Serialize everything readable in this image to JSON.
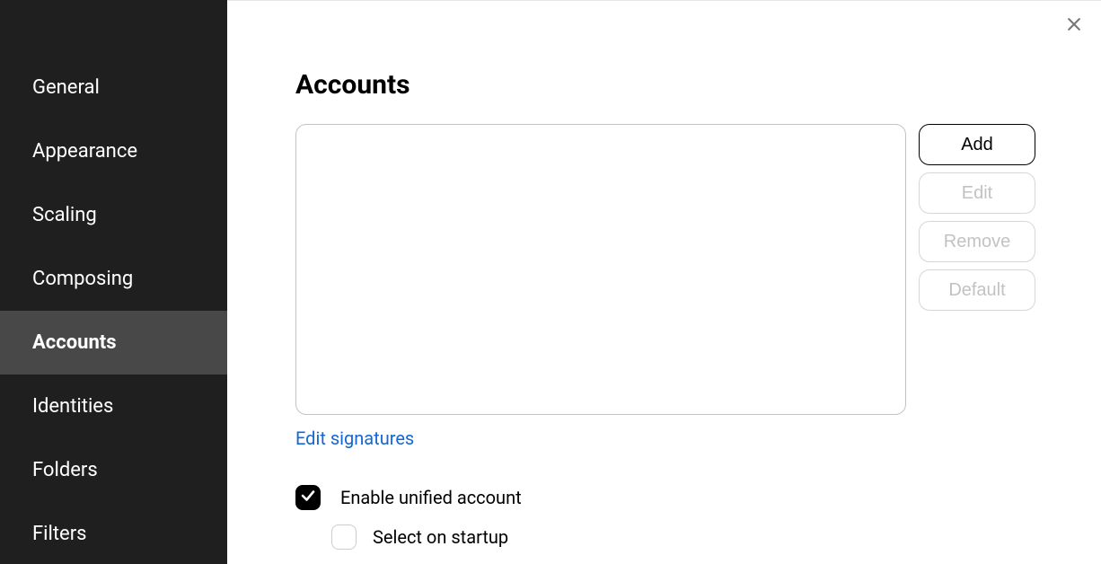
{
  "sidebar": {
    "items": [
      {
        "label": "General"
      },
      {
        "label": "Appearance"
      },
      {
        "label": "Scaling"
      },
      {
        "label": "Composing"
      },
      {
        "label": "Accounts",
        "selected": true
      },
      {
        "label": "Identities"
      },
      {
        "label": "Folders"
      },
      {
        "label": "Filters"
      }
    ]
  },
  "main": {
    "title": "Accounts",
    "buttons": {
      "add": "Add",
      "edit": "Edit",
      "remove": "Remove",
      "default": "Default"
    },
    "edit_signatures_link": "Edit signatures",
    "options": {
      "enable_unified_label": "Enable unified account",
      "enable_unified_checked": true,
      "select_on_startup_label": "Select on startup",
      "select_on_startup_checked": false
    }
  }
}
